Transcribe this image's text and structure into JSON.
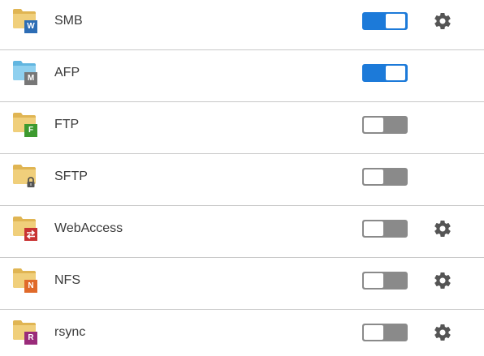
{
  "services": [
    {
      "label": "SMB",
      "badge": "W",
      "badge_color": "#2d6db5",
      "folder_color": "#f0cf7b",
      "folder_tab_color": "#e0b553",
      "enabled": true,
      "has_settings": true
    },
    {
      "label": "AFP",
      "badge": "M",
      "badge_color": "#777777",
      "folder_color": "#8fd0ef",
      "folder_tab_color": "#62b6e0",
      "enabled": true,
      "has_settings": false
    },
    {
      "label": "FTP",
      "badge": "F",
      "badge_color": "#3d9a2f",
      "folder_color": "#f0cf7b",
      "folder_tab_color": "#e0b553",
      "enabled": false,
      "has_settings": false
    },
    {
      "label": "SFTP",
      "badge": "lock-icon",
      "badge_color": "#9a9a9a",
      "folder_color": "#f0cf7b",
      "folder_tab_color": "#e0b553",
      "enabled": false,
      "has_settings": false
    },
    {
      "label": "WebAccess",
      "badge": "arrows-icon",
      "badge_color": "#c83232",
      "folder_color": "#f0cf7b",
      "folder_tab_color": "#e0b553",
      "enabled": false,
      "has_settings": true
    },
    {
      "label": "NFS",
      "badge": "N",
      "badge_color": "#e06a2a",
      "folder_color": "#f0cf7b",
      "folder_tab_color": "#e0b553",
      "enabled": false,
      "has_settings": true
    },
    {
      "label": "rsync",
      "badge": "R",
      "badge_color": "#9a2b7a",
      "folder_color": "#f0cf7b",
      "folder_tab_color": "#e0b553",
      "enabled": false,
      "has_settings": true
    }
  ],
  "colors": {
    "toggle_on": "#1c7ad9",
    "toggle_off": "#8a8a8a",
    "gear": "#555555",
    "divider": "#c8c8c8"
  }
}
